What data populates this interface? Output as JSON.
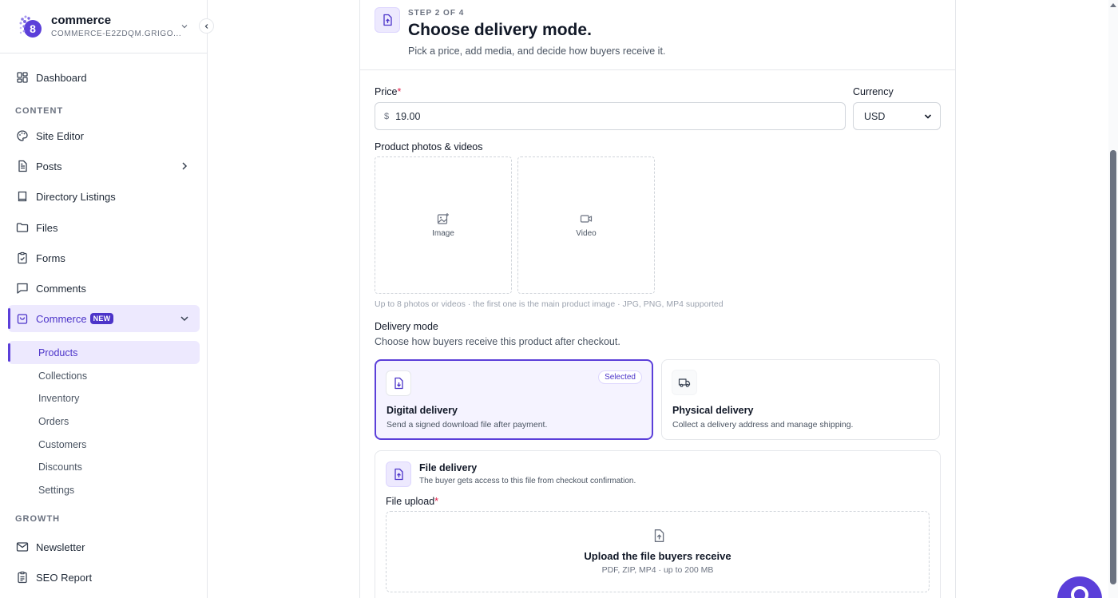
{
  "brand": {
    "name": "commerce",
    "subtitle": "COMMERCE-E2ZDQM.GRIGO..."
  },
  "sidebar": {
    "dashboard": "Dashboard",
    "sections": {
      "content": "CONTENT",
      "growth": "GROWTH"
    },
    "items": {
      "site_editor": "Site Editor",
      "posts": "Posts",
      "directory_listings": "Directory Listings",
      "files": "Files",
      "forms": "Forms",
      "comments": "Comments",
      "commerce": "Commerce",
      "commerce_badge": "NEW",
      "newsletter": "Newsletter",
      "seo_report": "SEO Report"
    },
    "commerce_sub": {
      "products": "Products",
      "collections": "Collections",
      "inventory": "Inventory",
      "orders": "Orders",
      "customers": "Customers",
      "discounts": "Discounts",
      "settings": "Settings"
    }
  },
  "step": {
    "label": "STEP 2 OF 4",
    "title": "Choose delivery mode.",
    "description": "Pick a price, add media, and decide how buyers receive it."
  },
  "form": {
    "price_label": "Price",
    "required_mark": "*",
    "currency_symbol": "$",
    "price_value": "19.00",
    "currency_label": "Currency",
    "currency_value": "USD",
    "media_label": "Product photos & videos",
    "media_image": "Image",
    "media_video": "Video",
    "media_hint": "Up to 8 photos or videos · the first one is the main product image · JPG, PNG, MP4 supported",
    "delivery_label": "Delivery mode",
    "delivery_desc": "Choose how buyers receive this product after checkout."
  },
  "delivery": {
    "digital": {
      "title": "Digital delivery",
      "description": "Send a signed download file after payment.",
      "badge": "Selected"
    },
    "physical": {
      "title": "Physical delivery",
      "description": "Collect a delivery address and manage shipping."
    }
  },
  "file_delivery": {
    "title": "File delivery",
    "description": "The buyer gets access to this file from checkout confirmation.",
    "upload_label": "File upload",
    "upload_title": "Upload the file buyers receive",
    "upload_sub": "PDF, ZIP, MP4 · up to 200 MB"
  },
  "colors": {
    "accent": "#5b3fd9",
    "accent_light": "#ede9fe",
    "required": "#e11d48"
  }
}
